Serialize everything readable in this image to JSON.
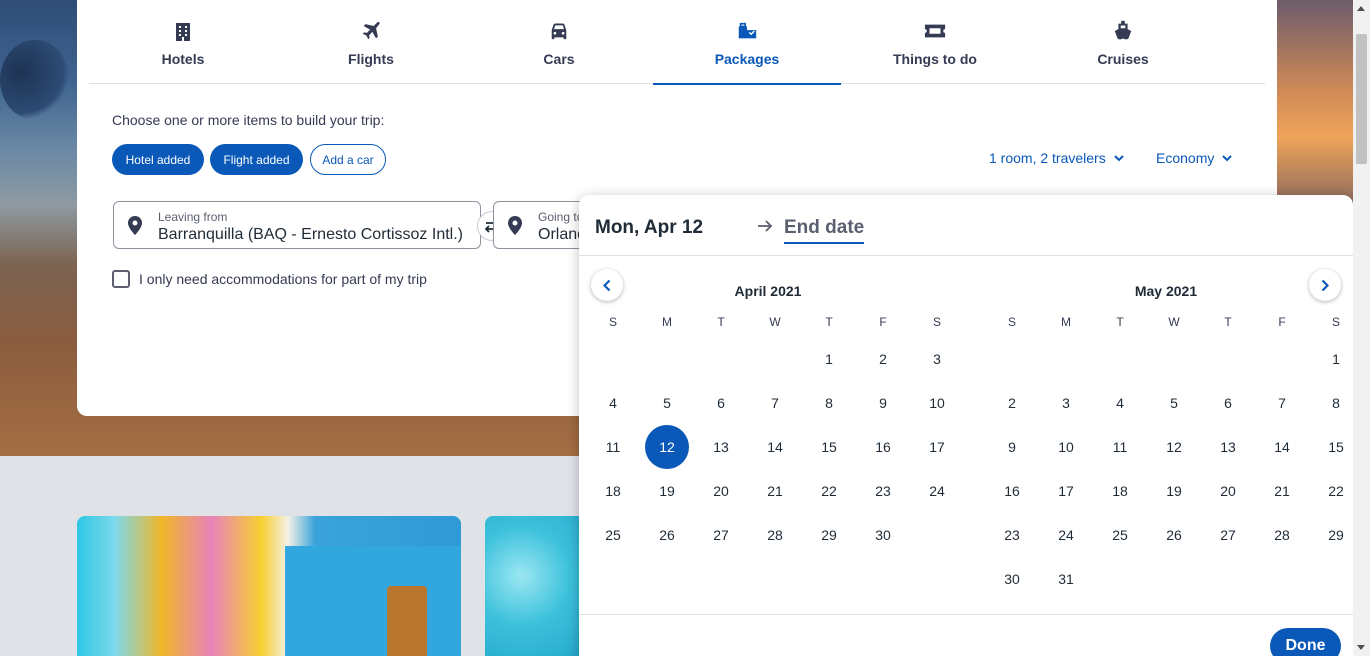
{
  "tabs": [
    {
      "label": "Hotels",
      "icon": "building-icon"
    },
    {
      "label": "Flights",
      "icon": "plane-icon"
    },
    {
      "label": "Cars",
      "icon": "car-icon"
    },
    {
      "label": "Packages",
      "icon": "package-icon",
      "active": true
    },
    {
      "label": "Things to do",
      "icon": "ticket-icon"
    },
    {
      "label": "Cruises",
      "icon": "ship-icon"
    }
  ],
  "search": {
    "intro": "Choose one or more items to build your trip:",
    "pills": {
      "hotel": "Hotel added",
      "flight": "Flight added",
      "car": "Add a car"
    },
    "travelers": "1 room, 2 travelers",
    "cabin": "Economy",
    "leaving_label": "Leaving from",
    "leaving_value": "Barranquilla (BAQ - Ernesto Cortissoz Intl.)",
    "going_label": "Going to",
    "going_value": "Orlando",
    "partial_label": "I only need accommodations for part of my trip"
  },
  "calendar": {
    "start_date": "Mon, Apr 12",
    "end_date": "End date",
    "done_label": "Done",
    "weekdays": [
      "S",
      "M",
      "T",
      "W",
      "T",
      "F",
      "S"
    ],
    "months": [
      {
        "title": "April 2021",
        "weeks": [
          [
            "",
            "",
            "",
            "",
            "1",
            "2",
            "3"
          ],
          [
            "4",
            "5",
            "6",
            "7",
            "8",
            "9",
            "10"
          ],
          [
            "11",
            "12",
            "13",
            "14",
            "15",
            "16",
            "17"
          ],
          [
            "18",
            "19",
            "20",
            "21",
            "22",
            "23",
            "24"
          ],
          [
            "25",
            "26",
            "27",
            "28",
            "29",
            "30",
            ""
          ]
        ],
        "selected": "12"
      },
      {
        "title": "May 2021",
        "weeks": [
          [
            "",
            "",
            "",
            "",
            "",
            "",
            "1"
          ],
          [
            "2",
            "3",
            "4",
            "5",
            "6",
            "7",
            "8"
          ],
          [
            "9",
            "10",
            "11",
            "12",
            "13",
            "14",
            "15"
          ],
          [
            "16",
            "17",
            "18",
            "19",
            "20",
            "21",
            "22"
          ],
          [
            "23",
            "24",
            "25",
            "26",
            "27",
            "28",
            "29"
          ],
          [
            "30",
            "31",
            "",
            "",
            "",
            "",
            ""
          ]
        ]
      }
    ]
  },
  "colors": {
    "accent": "#0a58b8",
    "text": "#1f2b37"
  }
}
